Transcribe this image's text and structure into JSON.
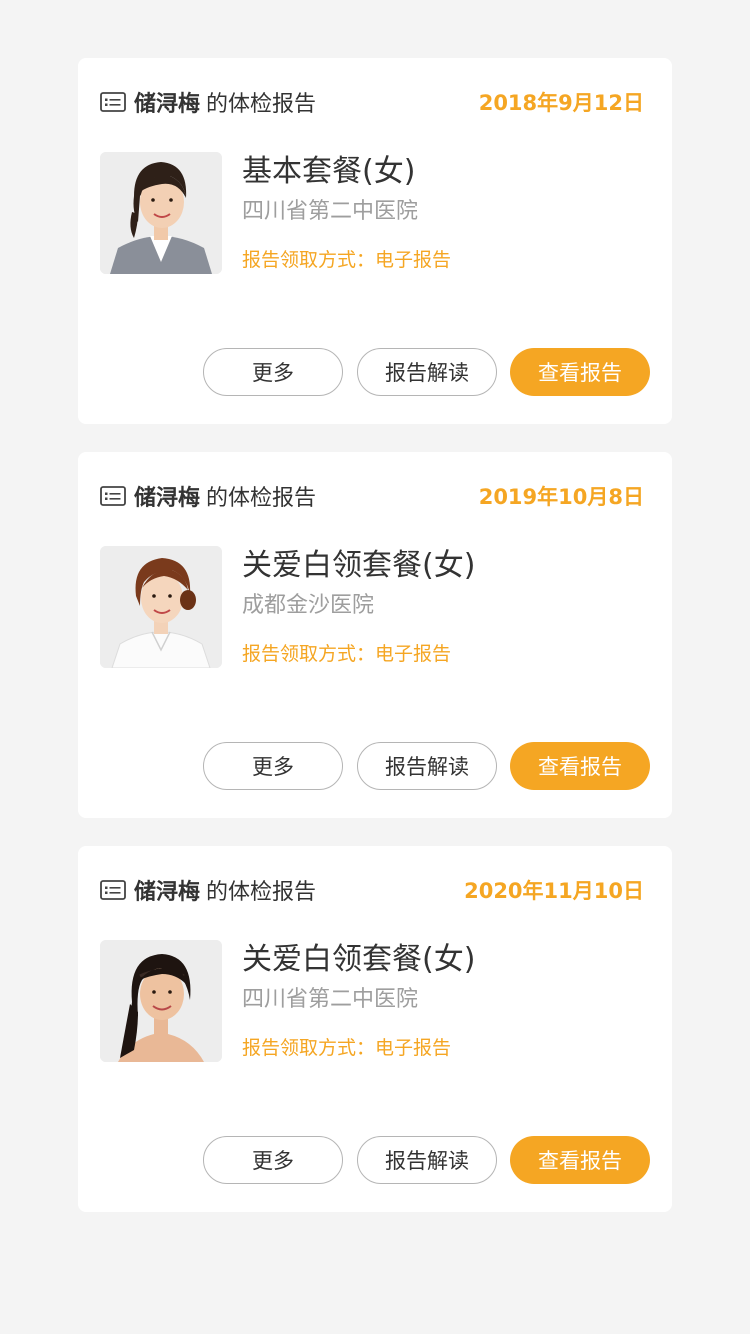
{
  "reports": [
    {
      "owner": "储浔梅",
      "owner_suffix": "的体检报告",
      "date": "2018年9月12日",
      "package": "基本套餐(女)",
      "hospital": "四川省第二中医院",
      "method": "报告领取方式：电子报告",
      "photo": "woman-portrait-grey-suit",
      "buttons": {
        "more": "更多",
        "interpret": "报告解读",
        "view": "查看报告"
      }
    },
    {
      "owner": "储浔梅",
      "owner_suffix": "的体检报告",
      "date": "2019年10月8日",
      "package": "关爱白领套餐(女)",
      "hospital": "成都金沙医院",
      "method": "报告领取方式：电子报告",
      "photo": "woman-portrait-white-blouse",
      "buttons": {
        "more": "更多",
        "interpret": "报告解读",
        "view": "查看报告"
      }
    },
    {
      "owner": "储浔梅",
      "owner_suffix": "的体检报告",
      "date": "2020年11月10日",
      "package": "关爱白领套餐(女)",
      "hospital": "四川省第二中医院",
      "method": "报告领取方式：电子报告",
      "photo": "woman-portrait-headband",
      "buttons": {
        "more": "更多",
        "interpret": "报告解读",
        "view": "查看报告"
      }
    }
  ],
  "colors": {
    "accent": "#f5a623",
    "background": "#f4f4f4",
    "card": "#ffffff",
    "text_primary": "#333333",
    "text_secondary": "#9e9e9e"
  }
}
